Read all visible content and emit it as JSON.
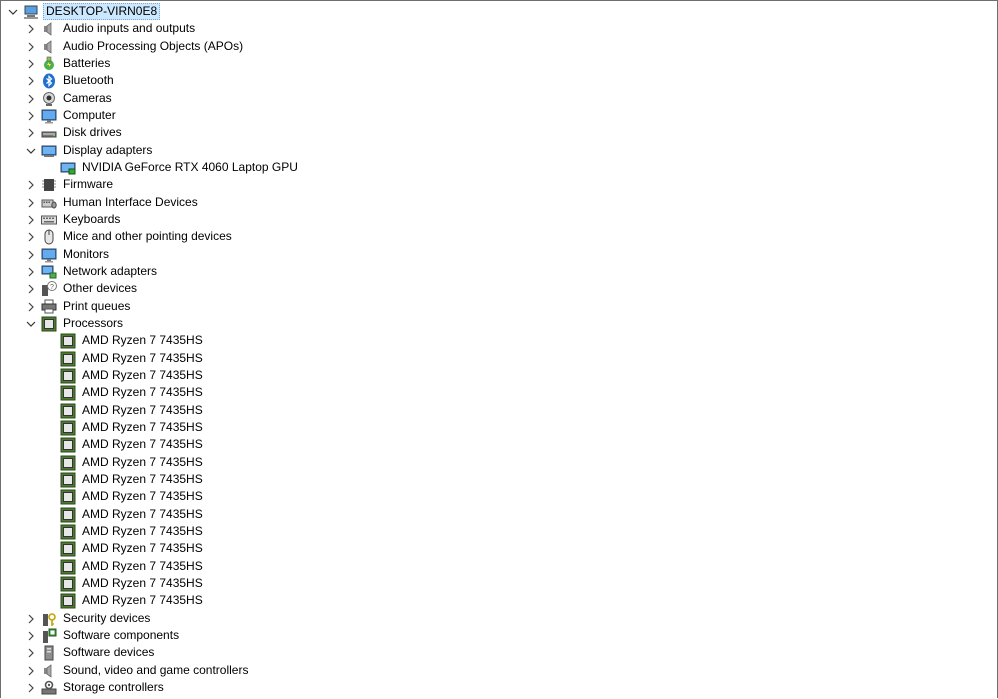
{
  "root": {
    "label": "DESKTOP-VIRN0E8",
    "icon": "computer-network-icon",
    "expanded": true
  },
  "categories": [
    {
      "label": "Audio inputs and outputs",
      "icon": "speaker-icon",
      "expanded": false
    },
    {
      "label": "Audio Processing Objects (APOs)",
      "icon": "speaker-icon",
      "expanded": false
    },
    {
      "label": "Batteries",
      "icon": "battery-icon",
      "expanded": false
    },
    {
      "label": "Bluetooth",
      "icon": "bluetooth-icon",
      "expanded": false
    },
    {
      "label": "Cameras",
      "icon": "camera-icon",
      "expanded": false
    },
    {
      "label": "Computer",
      "icon": "monitor-icon",
      "expanded": false
    },
    {
      "label": "Disk drives",
      "icon": "disk-drive-icon",
      "expanded": false
    },
    {
      "label": "Display adapters",
      "icon": "display-adapter-icon",
      "expanded": true,
      "children": [
        "NVIDIA GeForce RTX 4060 Laptop GPU"
      ]
    },
    {
      "label": "Firmware",
      "icon": "firmware-icon",
      "expanded": false
    },
    {
      "label": "Human Interface Devices",
      "icon": "hid-icon",
      "expanded": false
    },
    {
      "label": "Keyboards",
      "icon": "keyboard-icon",
      "expanded": false
    },
    {
      "label": "Mice and other pointing devices",
      "icon": "mouse-icon",
      "expanded": false
    },
    {
      "label": "Monitors",
      "icon": "monitor-icon",
      "expanded": false
    },
    {
      "label": "Network adapters",
      "icon": "network-icon",
      "expanded": false
    },
    {
      "label": "Other devices",
      "icon": "unknown-device-icon",
      "expanded": false
    },
    {
      "label": "Print queues",
      "icon": "printer-icon",
      "expanded": false
    },
    {
      "label": "Processors",
      "icon": "processor-icon",
      "expanded": true,
      "children": [
        "AMD Ryzen 7 7435HS",
        "AMD Ryzen 7 7435HS",
        "AMD Ryzen 7 7435HS",
        "AMD Ryzen 7 7435HS",
        "AMD Ryzen 7 7435HS",
        "AMD Ryzen 7 7435HS",
        "AMD Ryzen 7 7435HS",
        "AMD Ryzen 7 7435HS",
        "AMD Ryzen 7 7435HS",
        "AMD Ryzen 7 7435HS",
        "AMD Ryzen 7 7435HS",
        "AMD Ryzen 7 7435HS",
        "AMD Ryzen 7 7435HS",
        "AMD Ryzen 7 7435HS",
        "AMD Ryzen 7 7435HS",
        "AMD Ryzen 7 7435HS"
      ]
    },
    {
      "label": "Security devices",
      "icon": "security-device-icon",
      "expanded": false
    },
    {
      "label": "Software components",
      "icon": "software-component-icon",
      "expanded": false
    },
    {
      "label": "Software devices",
      "icon": "software-device-icon",
      "expanded": false
    },
    {
      "label": "Sound, video and game controllers",
      "icon": "speaker-icon",
      "expanded": false
    },
    {
      "label": "Storage controllers",
      "icon": "storage-controller-icon",
      "expanded": false
    }
  ]
}
